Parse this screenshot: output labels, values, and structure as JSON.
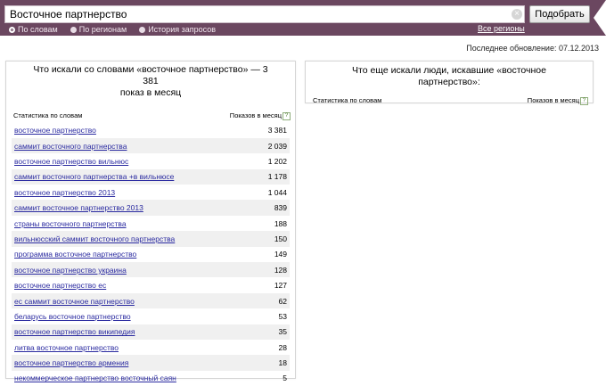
{
  "search": {
    "query": "Восточное партнерство",
    "clear_glyph": "×",
    "submit_label": "Подобрать"
  },
  "modes": [
    {
      "label": "По словам",
      "active": true
    },
    {
      "label": "По регионам",
      "active": false
    },
    {
      "label": "История запросов",
      "active": false
    }
  ],
  "regions_link": "Все регионы",
  "last_updated": "Последнее обновление: 07.12.2013",
  "left_panel": {
    "title_line1": "Что искали со словами «восточное партнерство» — 3 381",
    "title_line2": "показ в месяц",
    "col_query": "Статистика по словам",
    "col_count": "Показов в месяц",
    "help_glyph": "?",
    "rows": [
      {
        "query": "восточное партнерство",
        "count": "3 381"
      },
      {
        "query": "саммит восточного партнерства",
        "count": "2 039"
      },
      {
        "query": "восточное партнерство вильнюс",
        "count": "1 202"
      },
      {
        "query": "саммит восточного партнерства +в вильнюсе",
        "count": "1 178"
      },
      {
        "query": "восточное партнерство 2013",
        "count": "1 044"
      },
      {
        "query": "саммит восточное партнерство 2013",
        "count": "839"
      },
      {
        "query": "страны восточного партнерства",
        "count": "188"
      },
      {
        "query": "вильнюсский саммит восточного партнерства",
        "count": "150"
      },
      {
        "query": "программа восточное партнерство",
        "count": "149"
      },
      {
        "query": "восточное партнерство украина",
        "count": "128"
      },
      {
        "query": "восточное партнерство ес",
        "count": "127"
      },
      {
        "query": "ес саммит восточное партнерство",
        "count": "62"
      },
      {
        "query": "беларусь восточное партнерство",
        "count": "53"
      },
      {
        "query": "восточное партнерство википедия",
        "count": "35"
      },
      {
        "query": "литва восточное партнерство",
        "count": "28"
      },
      {
        "query": "восточное партнерство армения",
        "count": "18"
      },
      {
        "query": "некоммерческое партнерство восточный саян",
        "count": "5"
      }
    ]
  },
  "right_panel": {
    "title": "Что еще искали люди, искавшие «восточное партнерство»:",
    "col_query": "Статистика по словам",
    "col_count": "Показов в месяц",
    "help_glyph": "?"
  },
  "colors": {
    "topbar": "#6b4760",
    "link": "#2a2aa0",
    "row_alt": "#f0f0f0"
  }
}
